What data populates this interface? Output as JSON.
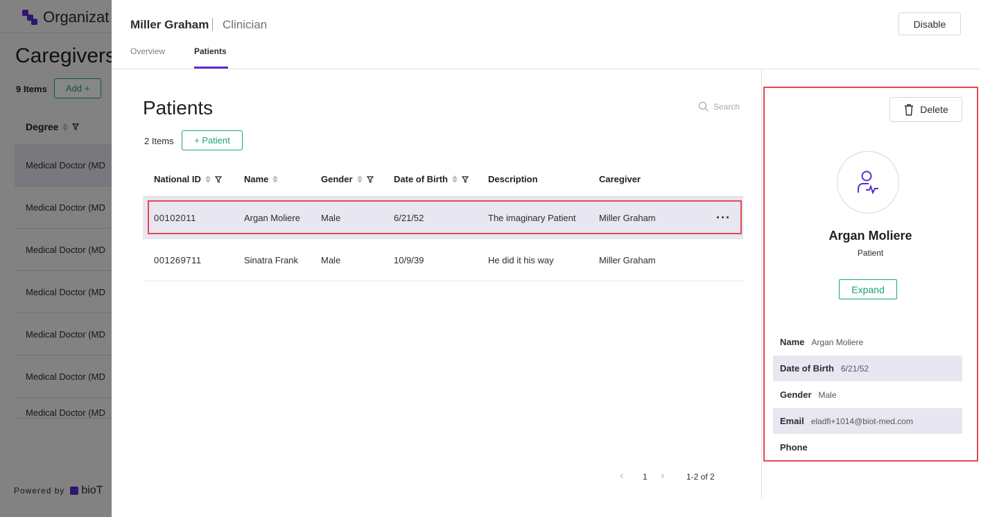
{
  "background": {
    "org_name": "Organizat",
    "page_title": "Caregivers",
    "item_count": "9 Items",
    "add_label": "Add +",
    "column_label": "Degree",
    "rows": [
      "Medical Doctor (MD",
      "Medical Doctor (MD",
      "Medical Doctor (MD",
      "Medical Doctor (MD",
      "Medical Doctor (MD",
      "Medical Doctor (MD",
      "Medical Doctor (MD"
    ],
    "powered_by": "Powered by",
    "brand": "bioT"
  },
  "modal": {
    "user_name": "Miller Graham",
    "user_role": "Clinician",
    "disable_label": "Disable",
    "tabs": [
      {
        "label": "Overview",
        "active": false
      },
      {
        "label": "Patients",
        "active": true
      }
    ],
    "content": {
      "title": "Patients",
      "search_placeholder": "Search",
      "item_count": "2 Items",
      "add_patient_label": "+ Patient",
      "table": {
        "columns": [
          "National ID",
          "Name",
          "Gender",
          "Date of Birth",
          "Description",
          "Caregiver"
        ],
        "rows": [
          {
            "national_id": "00102011",
            "name": "Argan Moliere",
            "gender": "Male",
            "dob": "6/21/52",
            "description": "The imaginary Patient",
            "caregiver": "Miller Graham",
            "more": "···"
          },
          {
            "national_id": "001269711",
            "name": "Sinatra Frank",
            "gender": "Male",
            "dob": "10/9/39",
            "description": "He did it his way",
            "caregiver": "Miller Graham"
          }
        ]
      },
      "pagination": {
        "prev": "‹",
        "page": "1",
        "next": "›",
        "range": "1-2 of 2"
      }
    },
    "detail": {
      "delete_label": "Delete",
      "name": "Argan Moliere",
      "role": "Patient",
      "expand_label": "Expand",
      "fields": [
        {
          "key": "Name",
          "value": "Argan Moliere"
        },
        {
          "key": "Date of Birth",
          "value": "6/21/52"
        },
        {
          "key": "Gender",
          "value": "Male"
        },
        {
          "key": "Email",
          "value": "eladfi+1014@biot-med.com"
        },
        {
          "key": "Phone",
          "value": ""
        }
      ]
    },
    "colors": {
      "accent": "#5b2bd1",
      "green": "#1aa37a",
      "highlight": "#e5484d"
    }
  }
}
